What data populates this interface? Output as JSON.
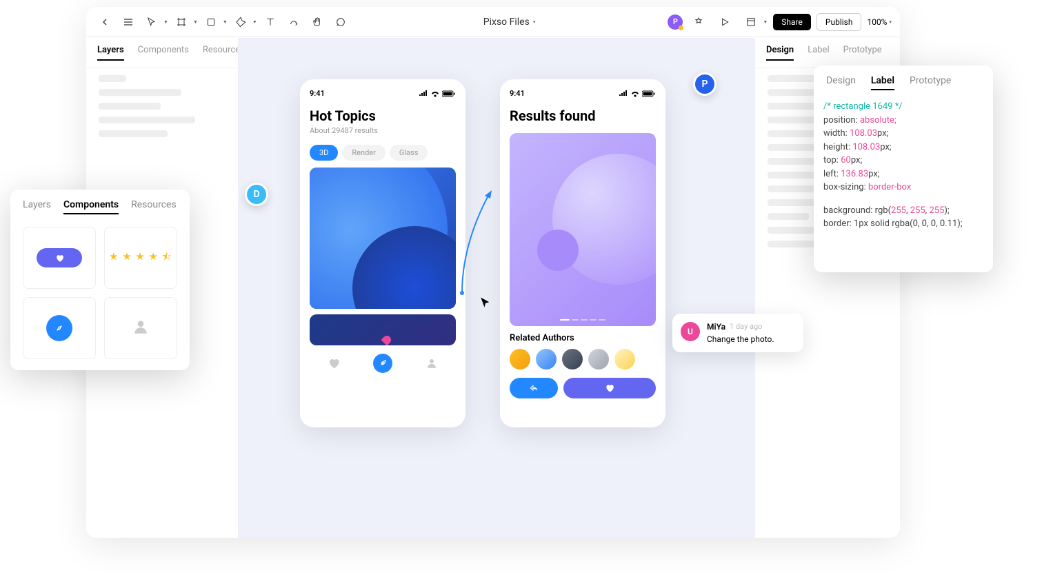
{
  "toolbar": {
    "title": "Pixso Files",
    "share": "Share",
    "publish": "Publish",
    "zoom": "100%"
  },
  "left_tabs": [
    "Layers",
    "Components",
    "Resources"
  ],
  "right_tabs": [
    "Design",
    "Label",
    "Prototype"
  ],
  "phone1": {
    "time": "9:41",
    "title": "Hot Topics",
    "subtitle": "About 29487 results",
    "tabs": [
      "3D",
      "Render",
      "Glass"
    ]
  },
  "phone2": {
    "time": "9:41",
    "title": "Results found",
    "related": "Related Authors"
  },
  "badges": {
    "d": "D",
    "p": "P",
    "avatar": "P"
  },
  "comment": {
    "avatar": "U",
    "name": "MiYa",
    "time": "1 day ago",
    "text": "Change the photo."
  },
  "comp_tabs": [
    "Layers",
    "Components",
    "Resources"
  ],
  "code_tabs": [
    "Design",
    "Label",
    "Prototype"
  ],
  "code": {
    "l1": "/* rectangle 1649 */",
    "l2a": "position: ",
    "l2b": "absolute;",
    "l3a": "width: ",
    "l3b": "108.03",
    "l3c": "px;",
    "l4a": "height: ",
    "l4b": "108.03",
    "l4c": "px;",
    "l5a": "top: ",
    "l5b": "60",
    "l5c": "px;",
    "l6a": "left: ",
    "l6b": "136.83",
    "l6c": "px;",
    "l7a": "box-sizing: ",
    "l7b": "border-box",
    "l8a": "background: rgb(",
    "l8b": "255",
    "l8c": ", ",
    "l8d": "255",
    "l8e": ", ",
    "l8f": "255",
    "l8g": ");",
    "l9": "border: 1px solid rgba(0, 0, 0, 0.11);"
  }
}
